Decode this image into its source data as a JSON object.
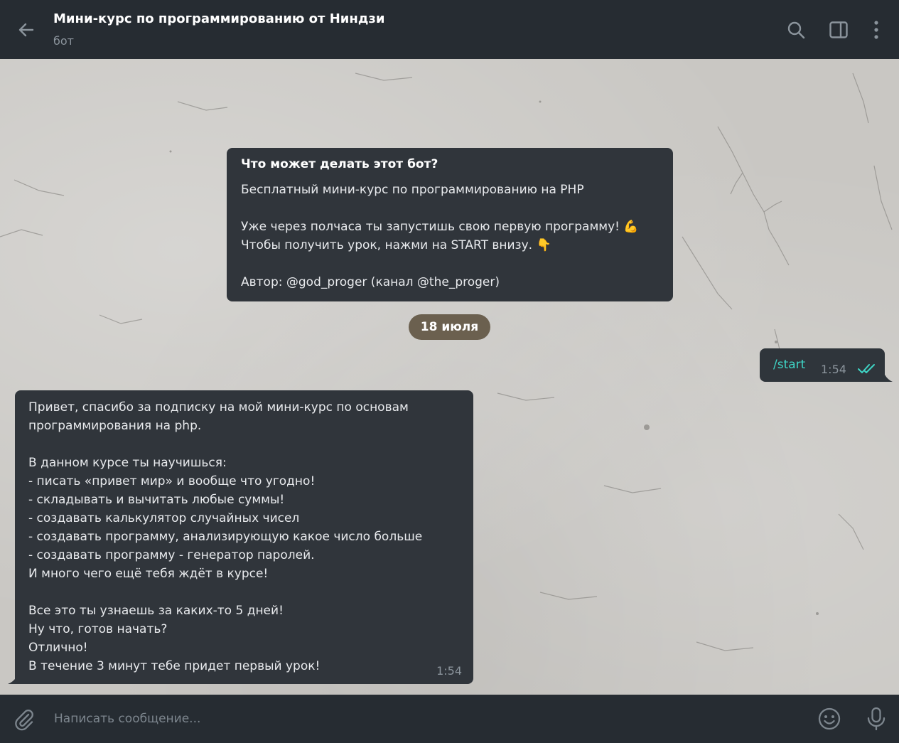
{
  "header": {
    "title": "Мини-курс по программированию от Ниндзи",
    "subtitle": "бот",
    "icons": [
      "back-arrow-icon",
      "search-icon",
      "sidebar-toggle-icon",
      "more-vertical-icon"
    ]
  },
  "info": {
    "heading": "Что может делать этот бот?",
    "line1": "Бесплатный мини-курс по программированию на PHP",
    "line2": "Уже через полчаса ты запустишь свою первую программу! 💪",
    "line3": "Чтобы получить урок, нажми на START внизу. 👇",
    "line4": "Автор: @god_proger (канал @the_proger)"
  },
  "date_separator": "18 июля",
  "outgoing": {
    "text": "/start",
    "time": "1:54",
    "status": "read-double-check"
  },
  "incoming": {
    "lines": [
      "Привет, спасибо за подписку на мой мини-курс по основам",
      "программирования на php.",
      "",
      "В данном курсе ты научишься:",
      "- писать «привет мир» и вообще что угодно!",
      "- складывать и вычитать любые суммы!",
      "- создавать калькулятор случайных чисел",
      "- создавать программу, анализирующую какое число больше",
      "- создавать программу - генератор паролей.",
      "И много чего ещё тебя ждёт в курсе!",
      "",
      "Все это ты узнаешь за каких-то 5 дней!",
      "Ну что, готов начать?",
      "Отлично!",
      "В течение 3 минут тебе придет первый урок!"
    ],
    "time": "1:54"
  },
  "composer": {
    "placeholder": "Написать сообщение...",
    "icons": [
      "paperclip-icon",
      "emoji-icon",
      "microphone-icon"
    ]
  },
  "colors": {
    "header_bg": "#262c32",
    "bubble_bg": "#30353b",
    "accent_teal": "#3fd5c6",
    "date_pill_bg": "#6b604f"
  }
}
